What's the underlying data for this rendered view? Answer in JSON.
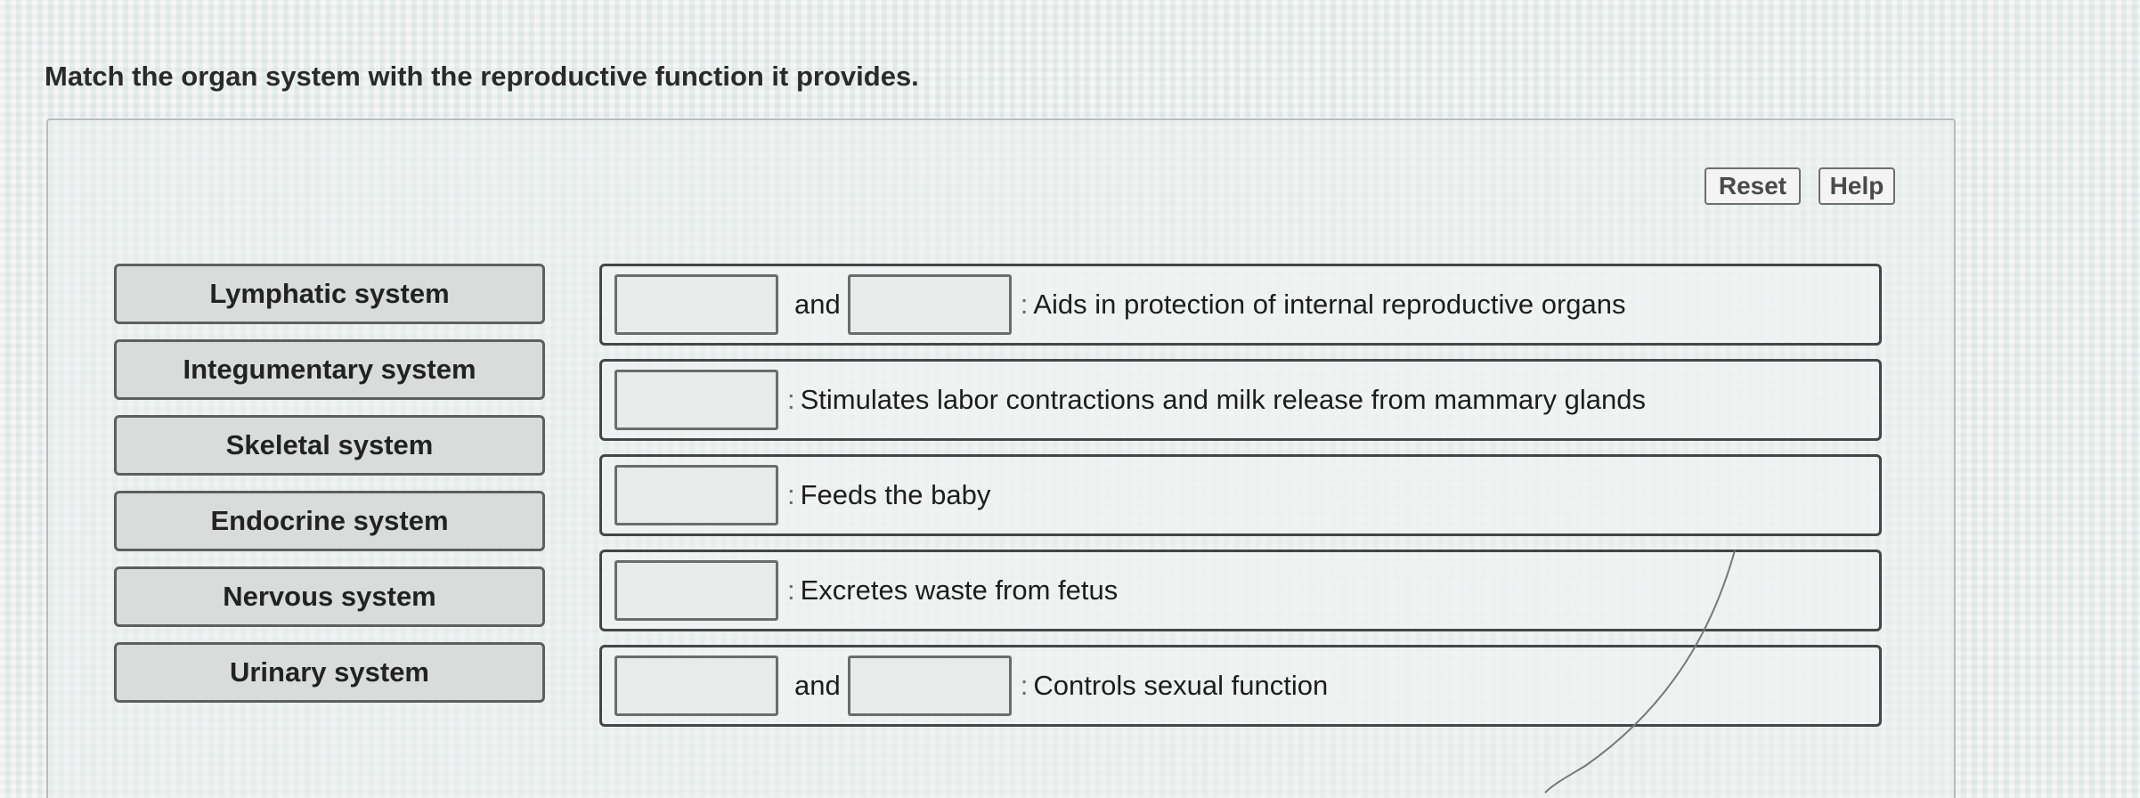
{
  "question": "Match the organ system with the reproductive function it provides.",
  "toolbar": {
    "reset_label": "Reset",
    "help_label": "Help"
  },
  "items": [
    {
      "label": "Lymphatic system"
    },
    {
      "label": "Integumentary system"
    },
    {
      "label": "Skeletal system"
    },
    {
      "label": "Endocrine system"
    },
    {
      "label": "Nervous system"
    },
    {
      "label": "Urinary system"
    }
  ],
  "targets": [
    {
      "slots": 2,
      "joiner": "and",
      "description": "Aids in protection of internal reproductive organs"
    },
    {
      "slots": 1,
      "description": "Stimulates labor contractions and milk release from mammary glands"
    },
    {
      "slots": 1,
      "description": "Feeds the baby"
    },
    {
      "slots": 1,
      "description": "Excretes waste from fetus"
    },
    {
      "slots": 2,
      "joiner": "and",
      "description": "Controls sexual function"
    }
  ],
  "separator": ":"
}
